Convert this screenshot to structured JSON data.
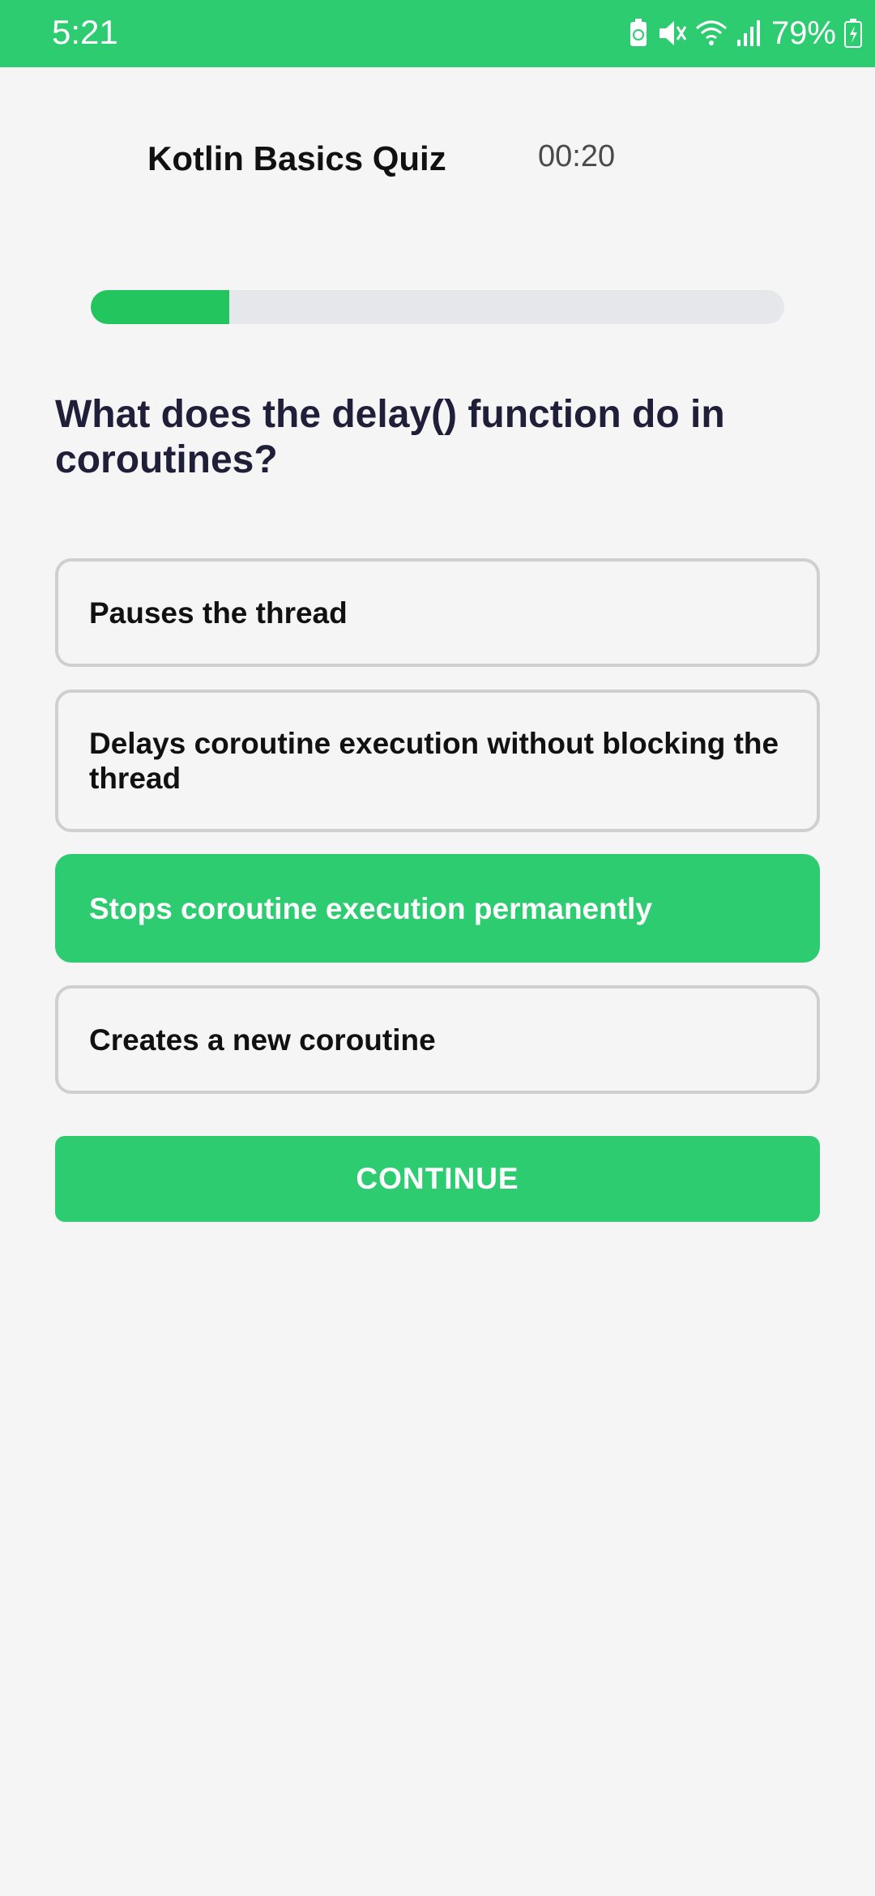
{
  "status_bar": {
    "time": "5:21",
    "battery_percent": "79%",
    "icons": [
      "battery-saver-icon",
      "mute-icon",
      "wifi-icon",
      "signal-icon",
      "battery-charging-icon"
    ],
    "color": "#2ecc71"
  },
  "header": {
    "title": "Kotlin Basics Quiz",
    "timer": "00:20"
  },
  "progress": {
    "fraction": 0.2
  },
  "question": {
    "text": "What does the delay() function do in coroutines?"
  },
  "options": [
    {
      "label": "Pauses the thread",
      "selected": false
    },
    {
      "label": "Delays coroutine execution without blocking the thread",
      "selected": false
    },
    {
      "label": "Stops coroutine execution permanently",
      "selected": true
    },
    {
      "label": "Creates a new coroutine",
      "selected": false
    }
  ],
  "continue_label": "CONTINUE",
  "colors": {
    "accent": "#2ecc71",
    "progress_fill": "#22c55e",
    "progress_track": "#e5e7eb",
    "question_text": "#1f1f3a"
  }
}
